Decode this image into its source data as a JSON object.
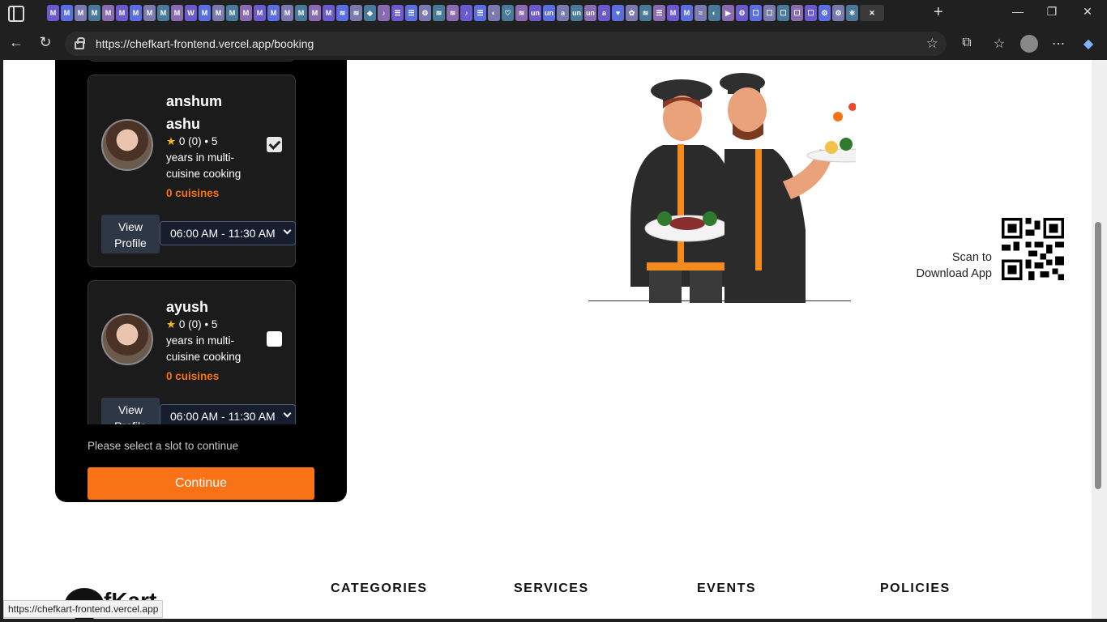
{
  "browser": {
    "url": "https://chefkart-frontend.vercel.app/booking",
    "tab_icons": [
      "M",
      "M",
      "M",
      "M",
      "M",
      "M",
      "M",
      "M",
      "M",
      "M",
      "W",
      "M",
      "M",
      "M",
      "M",
      "M",
      "M",
      "M",
      "M",
      "M",
      "M",
      "≋",
      "≋",
      "◈",
      "♪",
      "☰",
      "☰",
      "⚙",
      "≋",
      "≋",
      "♪",
      "☰",
      "◐",
      "♡",
      "≋",
      "un",
      "un",
      "a",
      "un",
      "un",
      "a",
      "♥",
      "✿",
      "≋",
      "☰",
      "M",
      "M",
      "≈",
      "◐",
      "▶",
      "⚙",
      "☐",
      "☐",
      "☐",
      "☐",
      "☐",
      "⚙",
      "⚙",
      "⚛"
    ],
    "active_tab_icon": "close-icon",
    "status_url": "https://chefkart-frontend.vercel.app"
  },
  "booking": {
    "chefs": [
      {
        "name": "anshum ashu",
        "rating": "★",
        "rating_text": "0 (0) • 5",
        "experience": "years in multi-cuisine cooking",
        "cuisines": "0 cuisines",
        "selected": true,
        "view_profile": "View Profile",
        "slot": "06:00 AM - 11:30 AM"
      },
      {
        "name": "ayush",
        "rating": "★",
        "rating_text": "0 (0) • 5",
        "experience": "years in multi-cuisine cooking",
        "cuisines": "0 cuisines",
        "selected": false,
        "view_profile": "View Profile",
        "slot": "06:00 AM - 11:30 AM"
      }
    ],
    "hint": "Please select a slot to continue",
    "continue_label": "Continue"
  },
  "promo": {
    "scan_line1": "Scan to",
    "scan_line2": "Download App"
  },
  "footer": {
    "categories": "CATEGORIES",
    "services": "SERVICES",
    "events": "EVENTS",
    "policies": "POLICIES",
    "logo_text": "fKart"
  },
  "colors": {
    "accent": "#f97316",
    "panel": "#000000",
    "card": "#1b1b1b"
  }
}
